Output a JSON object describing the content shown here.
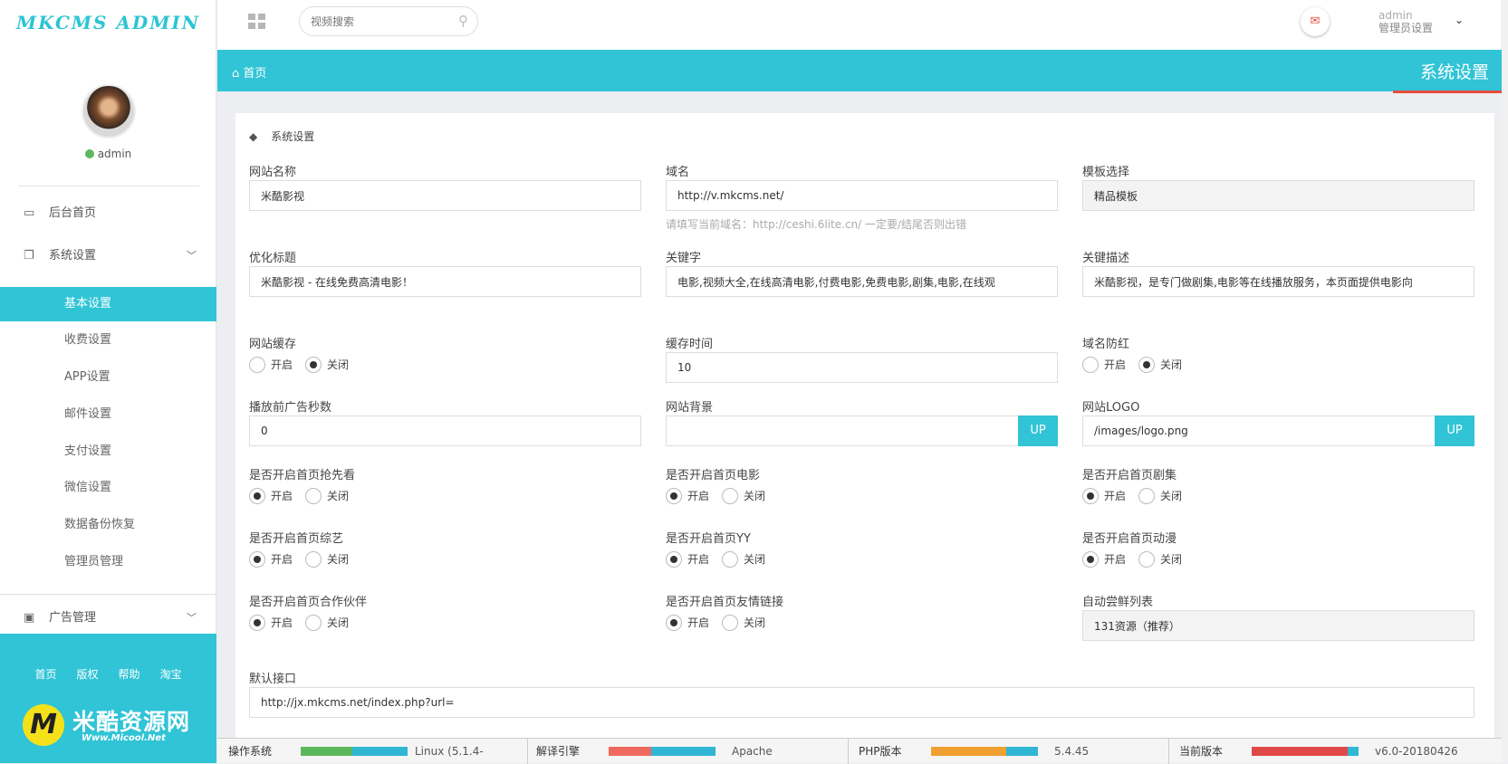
{
  "sidebar": {
    "logo": "MKCMS ADMIN",
    "username": "admin",
    "menu_home": "后台首页",
    "menu_system": "系统设置",
    "submenu": [
      "基本设置",
      "收费设置",
      "APP设置",
      "邮件设置",
      "支付设置",
      "微信设置",
      "数据备份恢复",
      "管理员管理"
    ],
    "menu_ads": "广告管理",
    "footer_links": [
      "首页",
      "版权",
      "帮助",
      "淘宝"
    ],
    "brand_name": "米酷资源网",
    "brand_url": "Www.Micool.Net"
  },
  "topbar": {
    "search_placeholder": "视频搜索",
    "admin_name": "admin",
    "admin_role": "管理员设置"
  },
  "crumb": {
    "home": "首页",
    "page_title": "系统设置"
  },
  "card": {
    "title": "系统设置"
  },
  "fields": {
    "site_name": {
      "label": "网站名称",
      "value": "米酷影视"
    },
    "domain": {
      "label": "域名",
      "value": "http://v.mkcms.net/",
      "hint": "请填写当前域名：http://ceshi.6lite.cn/ 一定要/结尾否则出错"
    },
    "template": {
      "label": "模板选择",
      "value": "精品模板"
    },
    "seo_title": {
      "label": "优化标题",
      "value": "米酷影视 - 在线免费高清电影！"
    },
    "keywords": {
      "label": "关键字",
      "value": "电影,视频大全,在线高清电影,付费电影,免费电影,剧集,电影,在线观"
    },
    "description": {
      "label": "关键描述",
      "value": "米酷影视，是专门做剧集,电影等在线播放服务，本页面提供电影向"
    },
    "site_cache": {
      "label": "网站缓存"
    },
    "cache_time": {
      "label": "缓存时间",
      "value": "10"
    },
    "domain_guard": {
      "label": "域名防红"
    },
    "ad_seconds": {
      "label": "播放前广告秒数",
      "value": "0"
    },
    "site_bg": {
      "label": "网站背景",
      "value": ""
    },
    "site_logo": {
      "label": "网站LOGO",
      "value": "/images/logo.png"
    },
    "home_preview": {
      "label": "是否开启首页抢先看"
    },
    "home_movie": {
      "label": "是否开启首页电影"
    },
    "home_series": {
      "label": "是否开启首页剧集"
    },
    "home_variety": {
      "label": "是否开启首页综艺"
    },
    "home_yy": {
      "label": "是否开启首页YY"
    },
    "home_anime": {
      "label": "是否开启首页动漫"
    },
    "home_partner": {
      "label": "是否开启首页合作伙伴"
    },
    "home_links": {
      "label": "是否开启首页友情链接"
    },
    "auto_list": {
      "label": "自动尝鲜列表",
      "value": "131资源（推荐）"
    },
    "default_api": {
      "label": "默认接口",
      "value": "http://jx.mkcms.net/index.php?url="
    }
  },
  "radio": {
    "on": "开启",
    "off": "关闭"
  },
  "up_label": "UP",
  "bottom": {
    "os_label": "操作系统",
    "os_value": "Linux (5.1.4-",
    "engine_label": "解译引擎",
    "engine_value": "Apache",
    "php_label": "PHP版本",
    "php_value": "5.4.45",
    "ver_label": "当前版本",
    "ver_value": "v6.0-20180426"
  },
  "colors": {
    "accent": "#30c4d6",
    "danger": "#e74c3c",
    "ok": "#5cb85c",
    "warn": "#f0a030"
  }
}
